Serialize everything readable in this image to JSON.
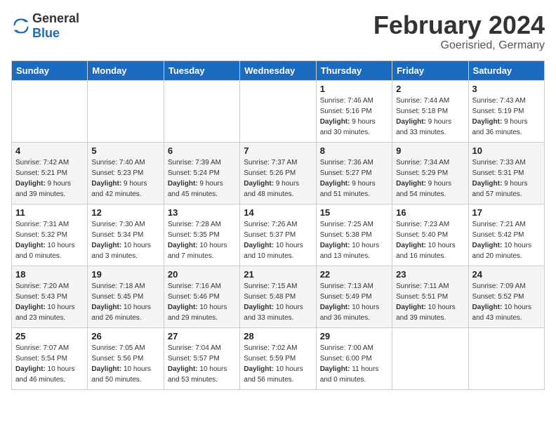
{
  "header": {
    "logo": {
      "general": "General",
      "blue": "Blue"
    },
    "title": "February 2024",
    "subtitle": "Goerisried, Germany"
  },
  "calendar": {
    "weekdays": [
      "Sunday",
      "Monday",
      "Tuesday",
      "Wednesday",
      "Thursday",
      "Friday",
      "Saturday"
    ],
    "weeks": [
      [
        {
          "day": "",
          "empty": true
        },
        {
          "day": "",
          "empty": true
        },
        {
          "day": "",
          "empty": true
        },
        {
          "day": "",
          "empty": true
        },
        {
          "day": "1",
          "sunrise": "7:46 AM",
          "sunset": "5:16 PM",
          "daylight": "9 hours and 30 minutes."
        },
        {
          "day": "2",
          "sunrise": "7:44 AM",
          "sunset": "5:18 PM",
          "daylight": "9 hours and 33 minutes."
        },
        {
          "day": "3",
          "sunrise": "7:43 AM",
          "sunset": "5:19 PM",
          "daylight": "9 hours and 36 minutes."
        }
      ],
      [
        {
          "day": "4",
          "sunrise": "7:42 AM",
          "sunset": "5:21 PM",
          "daylight": "9 hours and 39 minutes."
        },
        {
          "day": "5",
          "sunrise": "7:40 AM",
          "sunset": "5:23 PM",
          "daylight": "9 hours and 42 minutes."
        },
        {
          "day": "6",
          "sunrise": "7:39 AM",
          "sunset": "5:24 PM",
          "daylight": "9 hours and 45 minutes."
        },
        {
          "day": "7",
          "sunrise": "7:37 AM",
          "sunset": "5:26 PM",
          "daylight": "9 hours and 48 minutes."
        },
        {
          "day": "8",
          "sunrise": "7:36 AM",
          "sunset": "5:27 PM",
          "daylight": "9 hours and 51 minutes."
        },
        {
          "day": "9",
          "sunrise": "7:34 AM",
          "sunset": "5:29 PM",
          "daylight": "9 hours and 54 minutes."
        },
        {
          "day": "10",
          "sunrise": "7:33 AM",
          "sunset": "5:31 PM",
          "daylight": "9 hours and 57 minutes."
        }
      ],
      [
        {
          "day": "11",
          "sunrise": "7:31 AM",
          "sunset": "5:32 PM",
          "daylight": "10 hours and 0 minutes."
        },
        {
          "day": "12",
          "sunrise": "7:30 AM",
          "sunset": "5:34 PM",
          "daylight": "10 hours and 3 minutes."
        },
        {
          "day": "13",
          "sunrise": "7:28 AM",
          "sunset": "5:35 PM",
          "daylight": "10 hours and 7 minutes."
        },
        {
          "day": "14",
          "sunrise": "7:26 AM",
          "sunset": "5:37 PM",
          "daylight": "10 hours and 10 minutes."
        },
        {
          "day": "15",
          "sunrise": "7:25 AM",
          "sunset": "5:38 PM",
          "daylight": "10 hours and 13 minutes."
        },
        {
          "day": "16",
          "sunrise": "7:23 AM",
          "sunset": "5:40 PM",
          "daylight": "10 hours and 16 minutes."
        },
        {
          "day": "17",
          "sunrise": "7:21 AM",
          "sunset": "5:42 PM",
          "daylight": "10 hours and 20 minutes."
        }
      ],
      [
        {
          "day": "18",
          "sunrise": "7:20 AM",
          "sunset": "5:43 PM",
          "daylight": "10 hours and 23 minutes."
        },
        {
          "day": "19",
          "sunrise": "7:18 AM",
          "sunset": "5:45 PM",
          "daylight": "10 hours and 26 minutes."
        },
        {
          "day": "20",
          "sunrise": "7:16 AM",
          "sunset": "5:46 PM",
          "daylight": "10 hours and 29 minutes."
        },
        {
          "day": "21",
          "sunrise": "7:15 AM",
          "sunset": "5:48 PM",
          "daylight": "10 hours and 33 minutes."
        },
        {
          "day": "22",
          "sunrise": "7:13 AM",
          "sunset": "5:49 PM",
          "daylight": "10 hours and 36 minutes."
        },
        {
          "day": "23",
          "sunrise": "7:11 AM",
          "sunset": "5:51 PM",
          "daylight": "10 hours and 39 minutes."
        },
        {
          "day": "24",
          "sunrise": "7:09 AM",
          "sunset": "5:52 PM",
          "daylight": "10 hours and 43 minutes."
        }
      ],
      [
        {
          "day": "25",
          "sunrise": "7:07 AM",
          "sunset": "5:54 PM",
          "daylight": "10 hours and 46 minutes."
        },
        {
          "day": "26",
          "sunrise": "7:05 AM",
          "sunset": "5:56 PM",
          "daylight": "10 hours and 50 minutes."
        },
        {
          "day": "27",
          "sunrise": "7:04 AM",
          "sunset": "5:57 PM",
          "daylight": "10 hours and 53 minutes."
        },
        {
          "day": "28",
          "sunrise": "7:02 AM",
          "sunset": "5:59 PM",
          "daylight": "10 hours and 56 minutes."
        },
        {
          "day": "29",
          "sunrise": "7:00 AM",
          "sunset": "6:00 PM",
          "daylight": "11 hours and 0 minutes."
        },
        {
          "day": "",
          "empty": true
        },
        {
          "day": "",
          "empty": true
        }
      ]
    ]
  }
}
